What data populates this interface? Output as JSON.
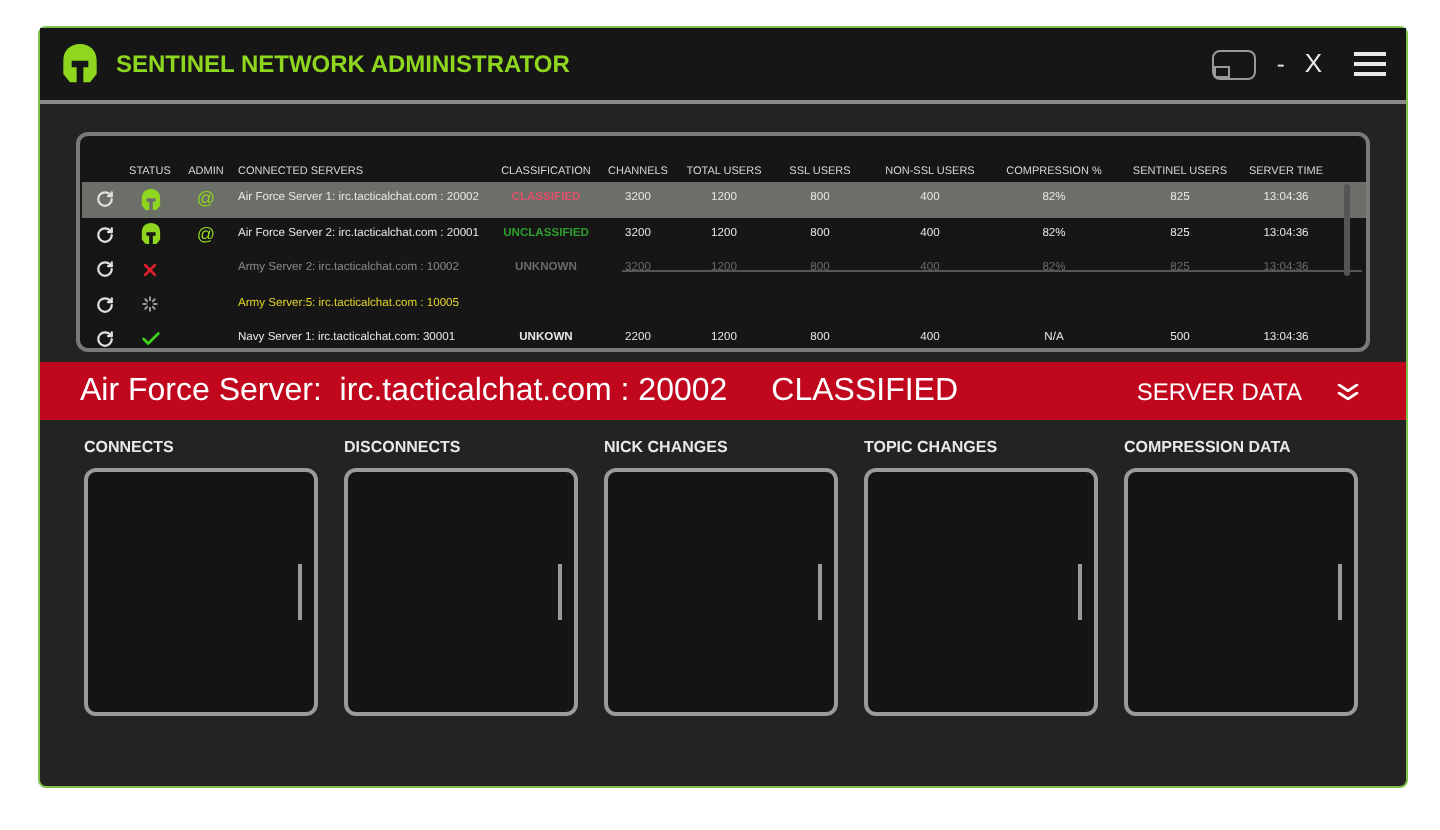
{
  "window": {
    "title": "SENTINEL NETWORK ADMINISTRATOR",
    "minimize": "-",
    "close": "X"
  },
  "table": {
    "columns": [
      "STATUS",
      "ADMIN",
      "CONNECTED SERVERS",
      "CLASSIFICATION",
      "CHANNELS",
      "TOTAL USERS",
      "SSL USERS",
      "NON-SSL USERS",
      "COMPRESSION %",
      "SENTINEL USERS",
      "SERVER TIME"
    ],
    "rows": [
      {
        "kind": "helmet",
        "admin": "@",
        "server": "Air Force Server 1:  irc.tacticalchat.com : 20002",
        "classification": {
          "text": "CLASSIFIED",
          "color": "#e0506a"
        },
        "values": [
          "3200",
          "1200",
          "800",
          "400",
          "82%",
          "825",
          "13:04:36"
        ],
        "selected": true,
        "disabled": false
      },
      {
        "kind": "helmet",
        "admin": "@",
        "server": "Air Force Server 2:  irc.tacticalchat.com : 20001",
        "classification": {
          "text": "UNCLASSIFIED",
          "color": "#2e9e2e"
        },
        "values": [
          "3200",
          "1200",
          "800",
          "400",
          "82%",
          "825",
          "13:04:36"
        ],
        "selected": false,
        "disabled": false
      },
      {
        "kind": "error",
        "server": "Army Server 2:  irc.tacticalchat.com : 10002",
        "classification": {
          "text": "UNKNOWN",
          "color": "#6a6a6a"
        },
        "values": [
          "3200",
          "1200",
          "800",
          "400",
          "82%",
          "825",
          "13:04:36"
        ],
        "selected": false,
        "disabled": true
      },
      {
        "kind": "loading",
        "server": "Army Server:5:  irc.tacticalchat.com : 10005",
        "selected": false,
        "disabled": false,
        "color": "#e3d52a"
      },
      {
        "kind": "ok",
        "server": "Navy Server 1:  irc.tacticalchat.com:  30001",
        "classification": {
          "text": "UNKOWN",
          "color": "#e8e8e8"
        },
        "values": [
          "2200",
          "1200",
          "800",
          "400",
          "N/A",
          "500",
          "13:04:36"
        ],
        "selected": false,
        "disabled": false
      }
    ]
  },
  "banner": {
    "server": "Air Force Server:  irc.tacticalchat.com : 20002",
    "classification": "CLASSIFIED",
    "action": "SERVER DATA"
  },
  "panels": [
    "CONNECTS",
    "DISCONNECTS",
    "NICK CHANGES",
    "TOPIC CHANGES",
    "COMPRESSION DATA"
  ]
}
